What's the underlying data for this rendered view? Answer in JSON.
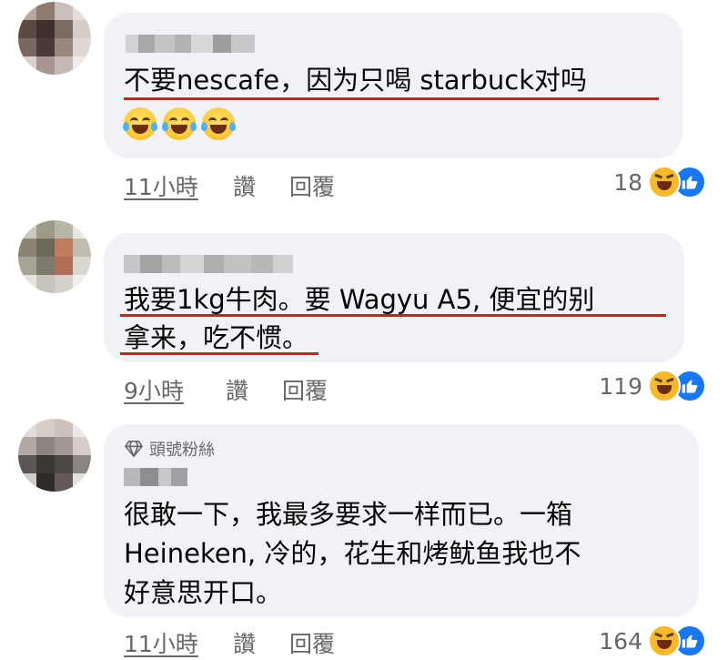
{
  "comments": [
    {
      "lines": [
        "不要nescafe，因为只喝 starbuck对吗"
      ],
      "time": "11小時",
      "like_label": "讚",
      "reply_label": "回覆",
      "reaction_count": "18"
    },
    {
      "lines": [
        "我要1kg牛肉。要 Wagyu A5, 便宜的别",
        "拿来，吃不惯。"
      ],
      "time": "9小時",
      "like_label": "讚",
      "reply_label": "回覆",
      "reaction_count": "119"
    },
    {
      "badge": "頭號粉絲",
      "lines": [
        "很敢一下，我最多要求一样而已。一箱",
        "Heineken, 冷的，花生和烤鱿鱼我也不",
        "好意思开口。"
      ],
      "time": "11小時",
      "like_label": "讚",
      "reply_label": "回覆",
      "reaction_count": "164"
    }
  ],
  "icons": {
    "reaction_haha": "haha-icon",
    "reaction_like": "like-icon",
    "top_fan": "diamond-icon",
    "emoji": "tears-of-joy-emoji"
  },
  "colors": {
    "bubble": "#f0f2f5",
    "underline": "#e0161e",
    "like_blue": "#1877f2",
    "meta_gray": "#65676b"
  }
}
